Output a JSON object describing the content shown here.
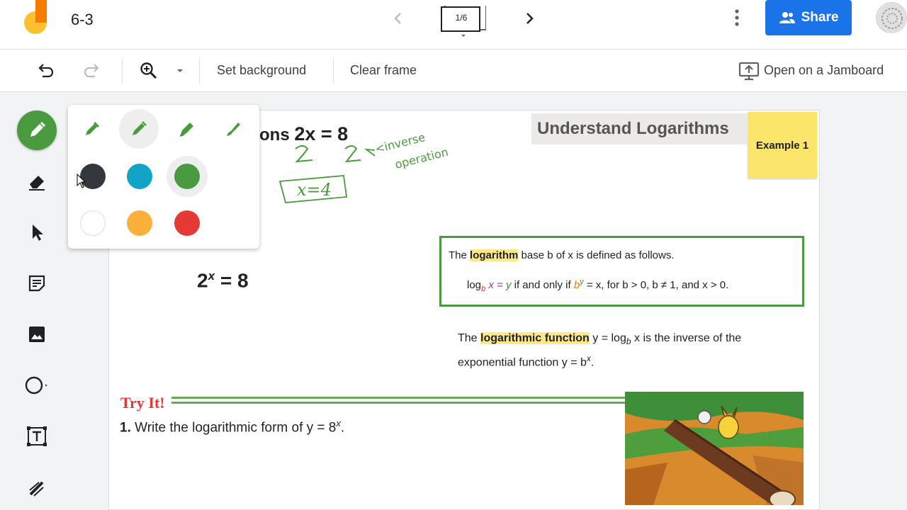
{
  "header": {
    "title": "6-3",
    "frame_indicator": "1/6",
    "share_label": "Share"
  },
  "toolbar": {
    "set_background": "Set background",
    "clear_frame": "Clear frame",
    "open_jamboard": "Open on a Jamboard"
  },
  "sidebar": {
    "tools": [
      "pen",
      "eraser",
      "select",
      "sticky-note",
      "image",
      "shape",
      "text-box",
      "laser"
    ],
    "active_tool": "pen"
  },
  "pen_popup": {
    "pen_types": [
      "marker",
      "pen",
      "highlighter",
      "brush"
    ],
    "selected_pen": "pen",
    "colors": [
      "#34373b",
      "#12a4c7",
      "#4a9b3f",
      "#ffffff",
      "#fbb03b",
      "#e53935"
    ],
    "selected_color": "#4a9b3f"
  },
  "slide": {
    "title": "Understand Logarithms",
    "sticky": "Example 1",
    "eq_top_prefix": "ons",
    "eq_top": "2x = 8",
    "handwriting_note_1": "<inverse",
    "handwriting_note_2": "operation",
    "handwriting_answer": "x=4",
    "eq_main_base": "2",
    "eq_main_exp": "x",
    "eq_main_rest": "= 8",
    "def_line1_a": "The",
    "def_line1_hl": "logarithm",
    "def_line1_b": "base b of x is defined as follows.",
    "def_line2": {
      "log": "log",
      "sub": "b",
      "xeq": "x =",
      "y": "y",
      "iff": "if and only if",
      "b": "b",
      "bexp": "y",
      "eqx": "= x, for b > 0, b ≠ 1, and x > 0."
    },
    "func_a": "The",
    "func_hl": "logarithmic function",
    "func_b": "y = log",
    "func_sub": "b",
    "func_c": "x is the inverse of the exponential function y = b",
    "func_exp": "x",
    "func_d": ".",
    "try_it": "Try It!",
    "q1_num": "1.",
    "q1_text": "Write the logarithmic form of y = 8",
    "q1_exp": "x",
    "q1_end": "."
  },
  "colors": {
    "accent_green": "#4a9b3f",
    "share_blue": "#1a73e8",
    "sticky_yellow": "#fbe56b",
    "try_red": "#e53935"
  }
}
